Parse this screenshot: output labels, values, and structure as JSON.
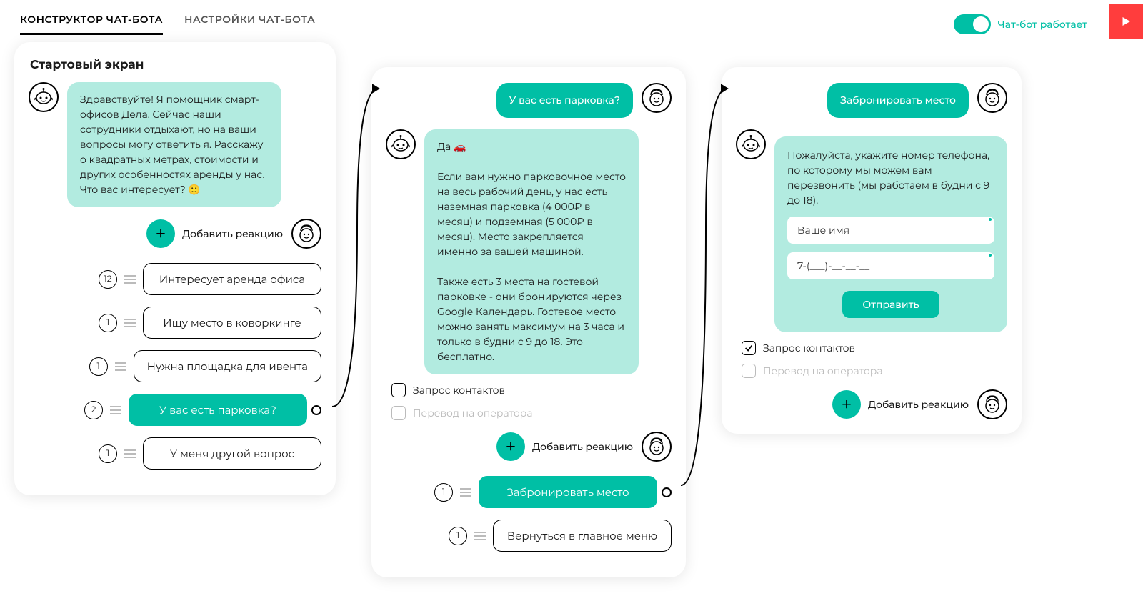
{
  "header": {
    "tabs": [
      "КОНСТРУКТОР ЧАТ-БОТА",
      "НАСТРОЙКИ ЧАТ-БОТА"
    ],
    "status_label": "Чат-бот работает"
  },
  "card1": {
    "title": "Стартовый экран",
    "bot_msg": "Здравствуйте! Я помощник смарт-офисов Дела. Сейчас наши сотрудники отдыхают, но на ваши вопросы могу ответить я. Расскажу о квадратных метрах, стоимости и других особенностях аренды у нас. Что вас интересует? 🙂",
    "add_label": "Добавить реакцию",
    "reactions": [
      {
        "count": "12",
        "label": "Интересует аренда офиса",
        "selected": false
      },
      {
        "count": "1",
        "label": "Ищу место в коворкинге",
        "selected": false
      },
      {
        "count": "1",
        "label": "Нужна площадка для ивента",
        "selected": false
      },
      {
        "count": "2",
        "label": "У вас есть парковка?",
        "selected": true
      },
      {
        "count": "1",
        "label": "У меня другой вопрос",
        "selected": false
      }
    ]
  },
  "card2": {
    "user_msg": "У вас есть парковка?",
    "bot_msg": "Да 🚗\n\nЕсли вам нужно парковочное место на весь рабочий день, у нас есть наземная парковка (4 000₽ в месяц) и подземная (5 000₽ в месяц). Место закрепляется именно за вашей машиной.\n\nТакже есть 3 места на гостевой парковке - они бронируются через Google Календарь. Гостевое место можно занять максимум на 3 часа и только в будни с 9 до 18. Это бесплатно.",
    "chk_contacts": "Запрос контактов",
    "chk_operator": "Перевод на оператора",
    "add_label": "Добавить реакцию",
    "reactions": [
      {
        "count": "1",
        "label": "Забронировать место",
        "selected": true
      },
      {
        "count": "1",
        "label": "Вернуться в главное меню",
        "selected": false
      }
    ]
  },
  "card3": {
    "user_msg": "Забронировать место",
    "form_intro": "Пожалуйста, укажите номер телефона, по которому мы можем вам перезвонить (мы работаем в будни с 9 до 18).",
    "name_placeholder": "Ваше имя",
    "phone_placeholder": "7-(___)-__-__-__",
    "submit": "Отправить",
    "chk_contacts": "Запрос контактов",
    "chk_operator": "Перевод на оператора",
    "add_label": "Добавить реакцию"
  }
}
